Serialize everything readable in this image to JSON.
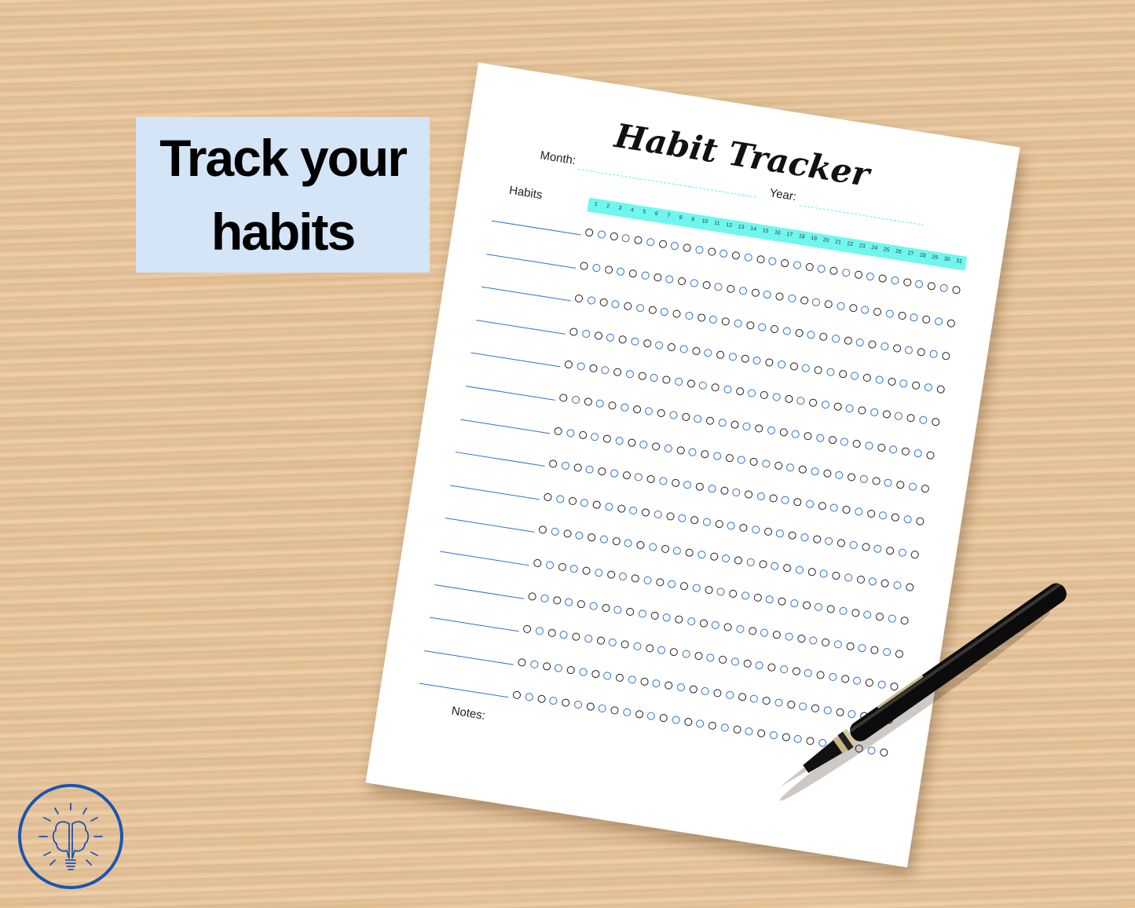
{
  "promo": {
    "line1": "Track your",
    "line2": "habits",
    "background": "#d5e5f8"
  },
  "sheet": {
    "title": "Habit Tracker",
    "month_label": "Month:",
    "year_label": "Year:",
    "habits_label": "Habits",
    "notes_label": "Notes:",
    "days": [
      "1",
      "2",
      "3",
      "4",
      "5",
      "6",
      "7",
      "8",
      "9",
      "10",
      "11",
      "12",
      "13",
      "14",
      "15",
      "16",
      "17",
      "18",
      "19",
      "20",
      "21",
      "22",
      "23",
      "24",
      "25",
      "26",
      "27",
      "28",
      "29",
      "30",
      "31"
    ],
    "habit_rows": 15,
    "colors": {
      "strip": "#6ff7ef",
      "circle_alt": "#2f6fd0",
      "circle": "#222222",
      "habit_line": "#2f6fd0"
    }
  },
  "logo": {
    "icon": "brain-lightbulb-icon",
    "color": "#1a56b0"
  },
  "decor": {
    "pen": "fountain-pen"
  }
}
